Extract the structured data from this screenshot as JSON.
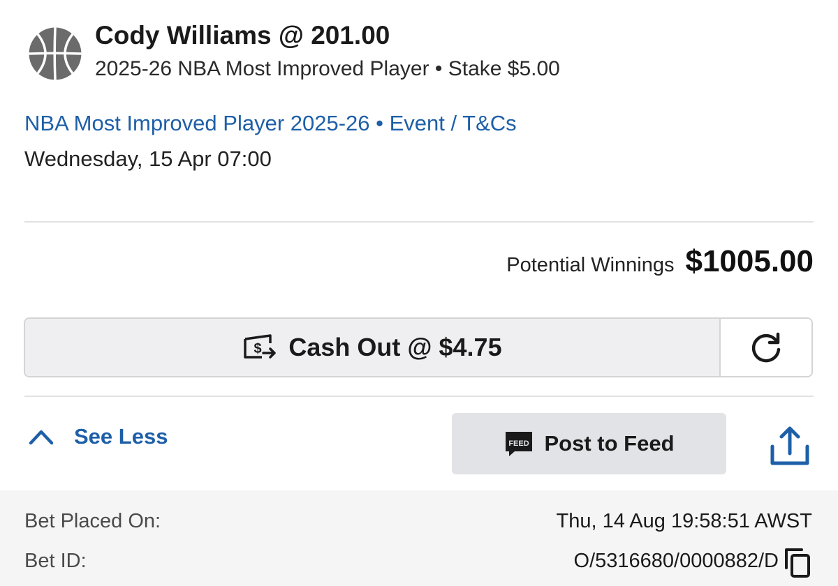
{
  "bet": {
    "title": "Cody Williams @ 201.00",
    "subtitle": "2025-26 NBA Most Improved Player • Stake $5.00",
    "event_link": "NBA Most Improved Player 2025-26 • Event / T&Cs",
    "event_date": "Wednesday, 15 Apr 07:00",
    "icon": "basketball-icon"
  },
  "winnings": {
    "label": "Potential Winnings",
    "value": "$1005.00"
  },
  "cashout": {
    "label": "Cash Out @ $4.75",
    "icon": "cash-out-icon",
    "refresh_icon": "refresh-icon"
  },
  "actions": {
    "see_less": "See Less",
    "post_to_feed": "Post to Feed",
    "feed_icon": "feed-icon",
    "share_icon": "share-icon"
  },
  "details": {
    "placed_label": "Bet Placed On:",
    "placed_value": "Thu, 14 Aug 19:58:51 AWST",
    "id_label": "Bet ID:",
    "id_value": "O/5316680/0000882/D",
    "copy_icon": "copy-icon"
  },
  "colors": {
    "link_blue": "#1e5fa8",
    "button_gray": "#efeff1",
    "details_bg": "#f5f5f5"
  }
}
